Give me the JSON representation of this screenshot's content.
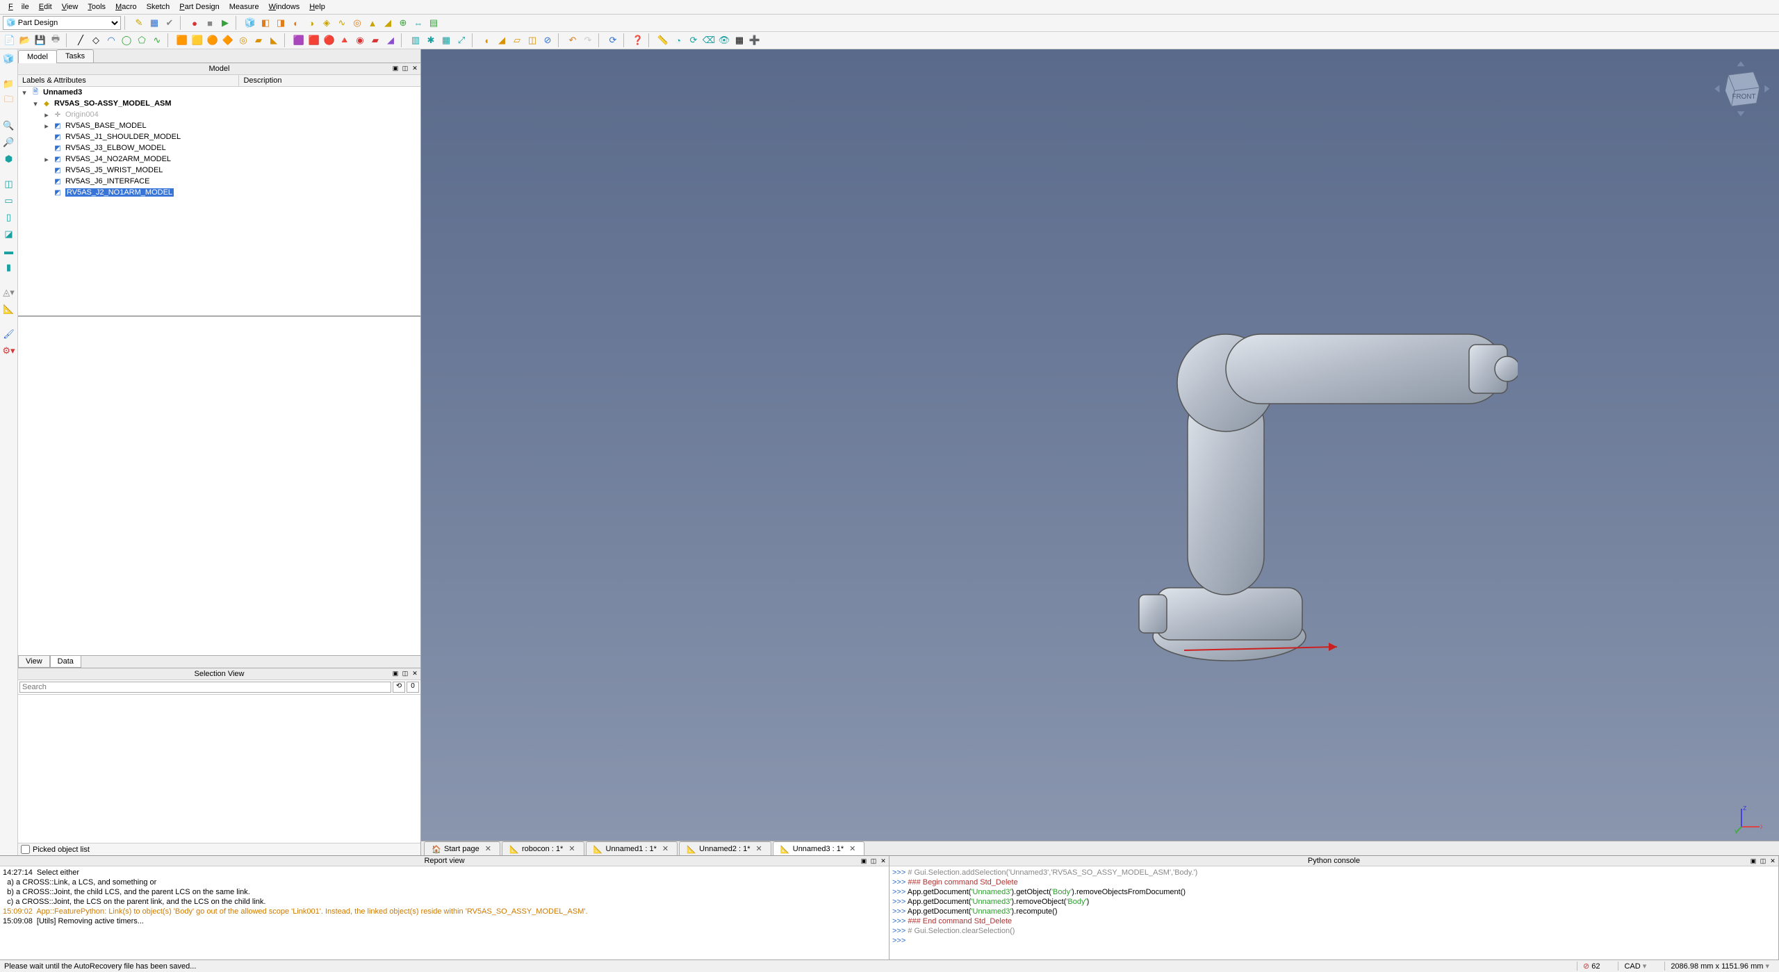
{
  "menu": {
    "file": "File",
    "edit": "Edit",
    "view": "View",
    "tools": "Tools",
    "macro": "Macro",
    "sketch": "Sketch",
    "partdesign": "Part Design",
    "measure": "Measure",
    "windows": "Windows",
    "help": "Help"
  },
  "workbench": {
    "options": [
      "Part Design"
    ],
    "selected": "Part Design"
  },
  "topTabs": {
    "model": "Model",
    "tasks": "Tasks"
  },
  "modelPanel": {
    "title": "Model",
    "col1": "Labels & Attributes",
    "col2": "Description"
  },
  "tree": {
    "root": "Unnamed3",
    "asm": "RV5AS_SO-ASSY_MODEL_ASM",
    "origin": "Origin004",
    "items": [
      "RV5AS_BASE_MODEL",
      "RV5AS_J1_SHOULDER_MODEL",
      "RV5AS_J3_ELBOW_MODEL",
      "RV5AS_J4_NO2ARM_MODEL",
      "RV5AS_J5_WRIST_MODEL",
      "RV5AS_J6_INTERFACE",
      "RV5AS_J2_NO1ARM_MODEL"
    ],
    "selectedIndex": 6
  },
  "propTabs": {
    "view": "View",
    "data": "Data"
  },
  "selectionPanel": {
    "title": "Selection View",
    "searchPlaceholder": "Search",
    "pickedLabel": "Picked object list",
    "count": "0"
  },
  "docTabs": [
    {
      "label": "Start page",
      "icon": "start",
      "closable": true,
      "active": false
    },
    {
      "label": "robocon : 1*",
      "icon": "doc",
      "closable": true,
      "active": false
    },
    {
      "label": "Unnamed1 : 1*",
      "icon": "doc",
      "closable": true,
      "active": false
    },
    {
      "label": "Unnamed2 : 1*",
      "icon": "doc",
      "closable": true,
      "active": false
    },
    {
      "label": "Unnamed3 : 1*",
      "icon": "doc",
      "closable": true,
      "active": true
    }
  ],
  "reportPanel": {
    "title": "Report view",
    "lines": [
      {
        "cls": "r-blk",
        "text": "14:27:14  Select either"
      },
      {
        "cls": "r-blk",
        "text": "  a) a CROSS::Link, a LCS, and something or"
      },
      {
        "cls": "r-blk",
        "text": "  b) a CROSS::Joint, the child LCS, and the parent LCS on the same link."
      },
      {
        "cls": "r-blk",
        "text": "  c) a CROSS::Joint, the LCS on the parent link, and the LCS on the child link."
      },
      {
        "cls": "r-orn",
        "text": "15:09:02  App::FeaturePython: Link(s) to object(s) 'Body' go out of the allowed scope 'Link001'. Instead, the linked object(s) reside within 'RV5AS_SO_ASSY_MODEL_ASM'."
      },
      {
        "cls": "r-blk",
        "text": "15:09:08  [Utils] Removing active timers..."
      }
    ]
  },
  "pythonPanel": {
    "title": "Python console",
    "prompt": ">>> ",
    "lines": [
      {
        "segments": [
          {
            "cls": "r-gry",
            "t": "# Gui.Selection.addSelection('Unnamed3','RV5AS_SO_ASSY_MODEL_ASM','Body.')"
          }
        ]
      },
      {
        "segments": [
          {
            "cls": "r-red",
            "t": "### Begin command Std_Delete"
          }
        ]
      },
      {
        "segments": [
          {
            "cls": "r-blk",
            "t": "App.getDocument("
          },
          {
            "cls": "r-grn",
            "t": "'Unnamed3'"
          },
          {
            "cls": "r-blk",
            "t": ").getObject("
          },
          {
            "cls": "r-grn",
            "t": "'Body'"
          },
          {
            "cls": "r-blk",
            "t": ").removeObjectsFromDocument()"
          }
        ]
      },
      {
        "segments": [
          {
            "cls": "r-blk",
            "t": "App.getDocument("
          },
          {
            "cls": "r-grn",
            "t": "'Unnamed3'"
          },
          {
            "cls": "r-blk",
            "t": ").removeObject("
          },
          {
            "cls": "r-grn",
            "t": "'Body'"
          },
          {
            "cls": "r-blk",
            "t": ")"
          }
        ]
      },
      {
        "segments": [
          {
            "cls": "r-blk",
            "t": "App.getDocument("
          },
          {
            "cls": "r-grn",
            "t": "'Unnamed3'"
          },
          {
            "cls": "r-blk",
            "t": ").recompute()"
          }
        ]
      },
      {
        "segments": [
          {
            "cls": "r-red",
            "t": "### End command Std_Delete"
          }
        ]
      },
      {
        "segments": [
          {
            "cls": "r-gry",
            "t": "# Gui.Selection.clearSelection()"
          }
        ]
      },
      {
        "segments": [
          {
            "cls": "r-blk",
            "t": ""
          }
        ]
      }
    ]
  },
  "statusbar": {
    "left": "Please wait until the AutoRecovery file has been saved...",
    "errIcon": "⊘",
    "errCount": "62",
    "cad": "CAD",
    "dims": "2086.98 mm x 1151.96 mm"
  },
  "navcube": {
    "face": "FRONT"
  }
}
